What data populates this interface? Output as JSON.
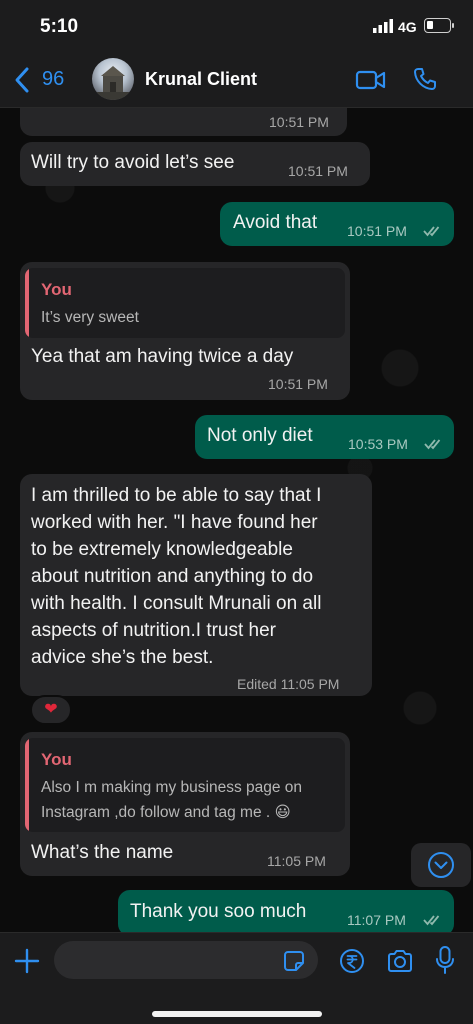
{
  "status_bar": {
    "time": "5:10",
    "network": "4G"
  },
  "header": {
    "back_count": "96",
    "contact_name": "Krunal Client"
  },
  "messages": [
    {
      "type": "incoming",
      "text": "",
      "time": "10:51 PM"
    },
    {
      "type": "incoming",
      "text": "Will try to avoid let’s see",
      "time": "10:51 PM"
    },
    {
      "type": "outgoing",
      "text": "Avoid that",
      "time": "10:51 PM",
      "status": "read"
    },
    {
      "type": "incoming",
      "quote_author": "You",
      "quote_text": "It’s very sweet",
      "text": "Yea that am having twice a day",
      "time": "10:51 PM"
    },
    {
      "type": "outgoing",
      "text": "Not only diet",
      "time": "10:53 PM",
      "status": "read"
    },
    {
      "type": "incoming",
      "text_lines": [
        "I am thrilled to be able to say that I",
        "worked with her. \"I have found her",
        "to be extremely knowledgeable",
        "about nutrition and anything to do",
        "with health. I consult Mrunali on all",
        "aspects of nutrition.I trust her",
        "advice she’s the best."
      ],
      "time": "Edited 11:05 PM",
      "reaction": "❤"
    },
    {
      "type": "incoming",
      "quote_author": "You",
      "quote_lines": [
        "Also I m making my business page on",
        "Instagram ,do follow and tag me . 😃"
      ],
      "text": "What’s the name",
      "time": "11:05 PM"
    },
    {
      "type": "outgoing",
      "text": "Thank you soo much",
      "time": "11:07 PM",
      "status": "read"
    }
  ],
  "input": {
    "placeholder": ""
  },
  "colors": {
    "accent": "#2f8ff0",
    "outgoing_bubble": "#005c4b",
    "incoming_bubble": "#262628",
    "quote_author": "#e26673",
    "read_ticks": "#8fb9ad"
  },
  "icons": [
    "back-chevron-icon",
    "video-call-icon",
    "phone-call-icon",
    "plus-icon",
    "sticker-icon",
    "payment-icon",
    "camera-icon",
    "microphone-icon",
    "chevron-down-icon",
    "double-tick-icon",
    "heart-icon"
  ]
}
